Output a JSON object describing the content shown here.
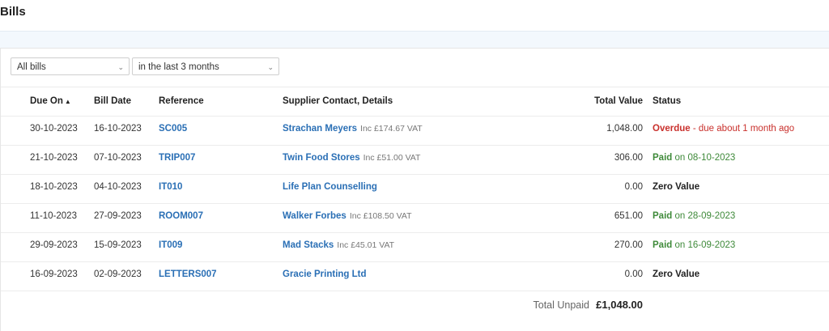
{
  "page": {
    "title": "Bills"
  },
  "filters": {
    "type": {
      "value": "All bills"
    },
    "period": {
      "value": "in the last 3 months"
    }
  },
  "table": {
    "headers": {
      "due_on": "Due On",
      "bill_date": "Bill Date",
      "reference": "Reference",
      "supplier": "Supplier Contact, Details",
      "total": "Total Value",
      "status": "Status"
    },
    "sort_icon": "sort-ascending-icon",
    "rows": [
      {
        "due_on": "30-10-2023",
        "bill_date": "16-10-2023",
        "reference": "SC005",
        "supplier": "Strachan Meyers",
        "vat": "Inc £174.67 VAT",
        "total": "1,048.00",
        "status": "Overdue",
        "status_note": " - due about 1 month ago",
        "status_type": "overdue"
      },
      {
        "due_on": "21-10-2023",
        "bill_date": "07-10-2023",
        "reference": "TRIP007",
        "supplier": "Twin Food Stores",
        "vat": "Inc £51.00 VAT",
        "total": "306.00",
        "status": "Paid",
        "status_note": " on 08-10-2023",
        "status_type": "paid"
      },
      {
        "due_on": "18-10-2023",
        "bill_date": "04-10-2023",
        "reference": "IT010",
        "supplier": "Life Plan Counselling",
        "vat": "",
        "total": "0.00",
        "status": "Zero Value",
        "status_note": "",
        "status_type": "zero"
      },
      {
        "due_on": "11-10-2023",
        "bill_date": "27-09-2023",
        "reference": "ROOM007",
        "supplier": "Walker Forbes",
        "vat": "Inc £108.50 VAT",
        "total": "651.00",
        "status": "Paid",
        "status_note": " on 28-09-2023",
        "status_type": "paid"
      },
      {
        "due_on": "29-09-2023",
        "bill_date": "15-09-2023",
        "reference": "IT009",
        "supplier": "Mad Stacks",
        "vat": "Inc £45.01 VAT",
        "total": "270.00",
        "status": "Paid",
        "status_note": " on 16-09-2023",
        "status_type": "paid"
      },
      {
        "due_on": "16-09-2023",
        "bill_date": "02-09-2023",
        "reference": "LETTERS007",
        "supplier": "Gracie Printing Ltd",
        "vat": "",
        "total": "0.00",
        "status": "Zero Value",
        "status_note": "",
        "status_type": "zero"
      }
    ]
  },
  "footer": {
    "label": "Total Unpaid",
    "value": "£1,048.00"
  },
  "colors": {
    "link": "#2a6fb5",
    "overdue": "#c9302c",
    "paid": "#3f8a3a"
  }
}
